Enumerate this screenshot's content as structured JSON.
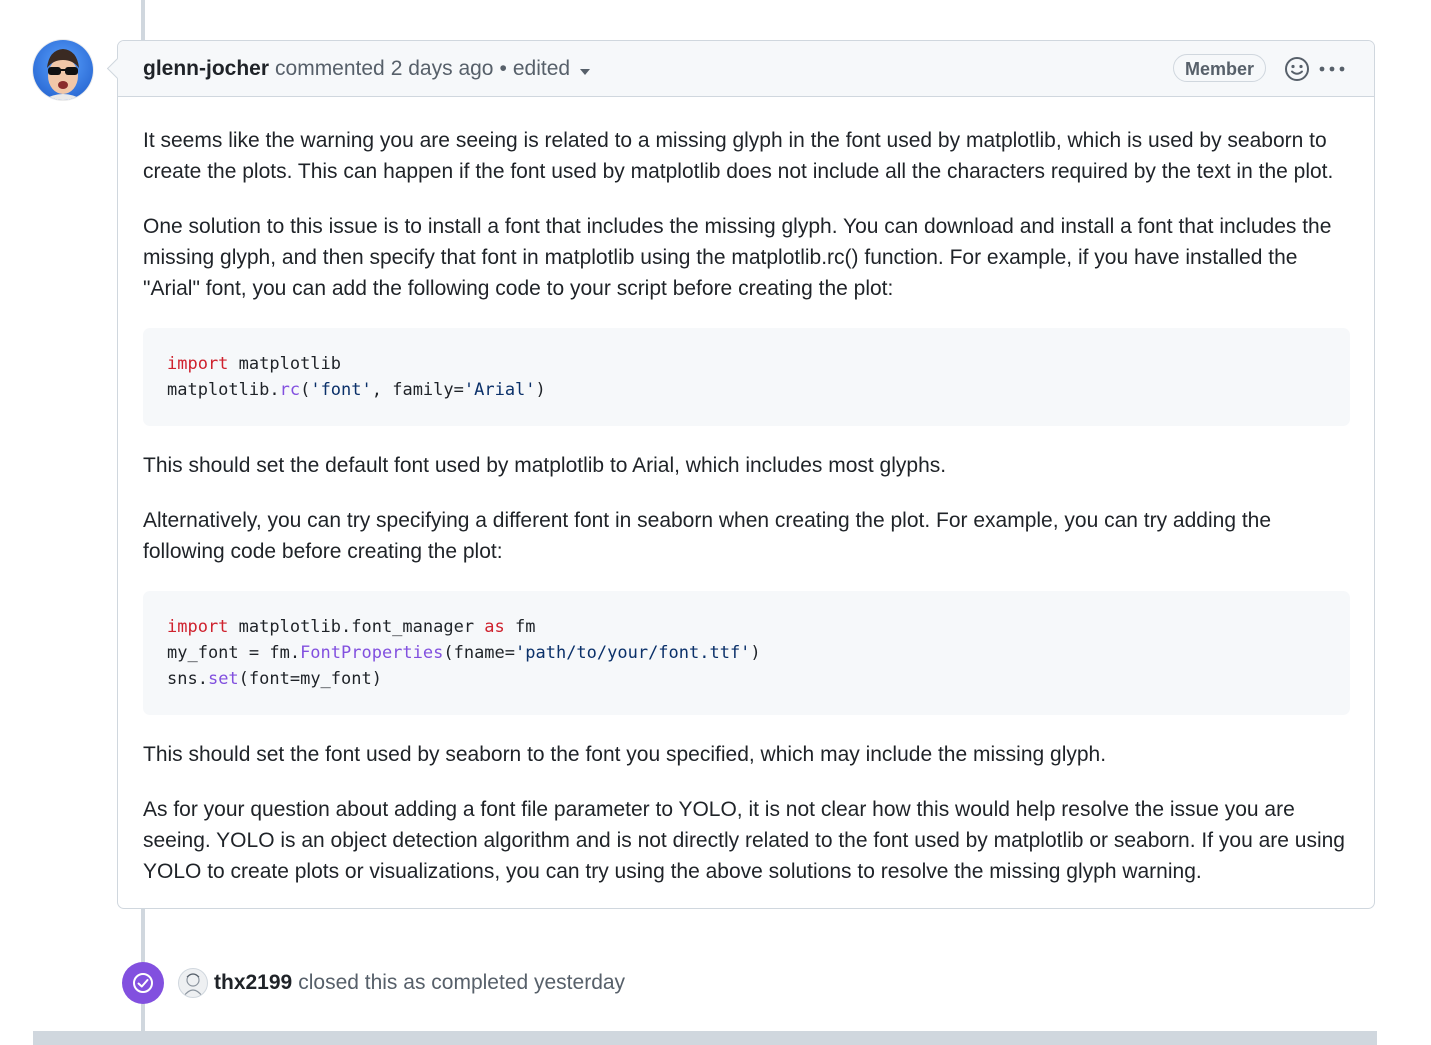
{
  "comment": {
    "author": "glenn-jocher",
    "action": "commented",
    "time": "2 days ago",
    "separator": "•",
    "edited_label": "edited",
    "badge": "Member",
    "icons": {
      "reaction": "smiley-icon",
      "more": "kebab-horizontal-icon",
      "edit_history": "triangle-down-icon"
    },
    "body": {
      "p1": "It seems like the warning you are seeing is related to a missing glyph in the font used by matplotlib, which is used by seaborn to create the plots. This can happen if the font used by matplotlib does not include all the characters required by the text in the plot.",
      "p2": "One solution to this issue is to install a font that includes the missing glyph. You can download and install a font that includes the missing glyph, and then specify that font in matplotlib using the matplotlib.rc() function. For example, if you have installed the \"Arial\" font, you can add the following code to your script before creating the plot:",
      "code1": {
        "line1_kw": "import",
        "line1_rest": " matplotlib",
        "line2_a": "matplotlib.",
        "line2_fn": "rc",
        "line2_b": "(",
        "line2_s1": "'font'",
        "line2_c": ", family=",
        "line2_s2": "'Arial'",
        "line2_d": ")"
      },
      "p3": "This should set the default font used by matplotlib to Arial, which includes most glyphs.",
      "p4": "Alternatively, you can try specifying a different font in seaborn when creating the plot. For example, you can try adding the following code before creating the plot:",
      "code2": {
        "line1_kw": "import",
        "line1_mid": " matplotlib.font_manager ",
        "line1_kw2": "as",
        "line1_end": " fm",
        "line2_a": "my_font = fm.",
        "line2_fn": "FontProperties",
        "line2_b": "(fname=",
        "line2_s": "'path/to/your/font.ttf'",
        "line2_c": ")",
        "line3_a": "sns.",
        "line3_fn": "set",
        "line3_b": "(font=my_font)"
      },
      "p5": "This should set the font used by seaborn to the font you specified, which may include the missing glyph.",
      "p6": "As for your question about adding a font file parameter to YOLO, it is not clear how this would help resolve the issue you are seeing. YOLO is an object detection algorithm and is not directly related to the font used by matplotlib or seaborn. If you are using YOLO to create plots or visualizations, you can try using the above solutions to resolve the missing glyph warning."
    }
  },
  "event": {
    "icon": "check-circle-icon",
    "actor": "thx2199",
    "text": "closed this as completed yesterday"
  },
  "colors": {
    "closed_purple": "#8250df",
    "keyword_red": "#cf222e",
    "function_purple": "#8250df",
    "string_blue": "#0a3069",
    "border": "#d0d7de"
  }
}
